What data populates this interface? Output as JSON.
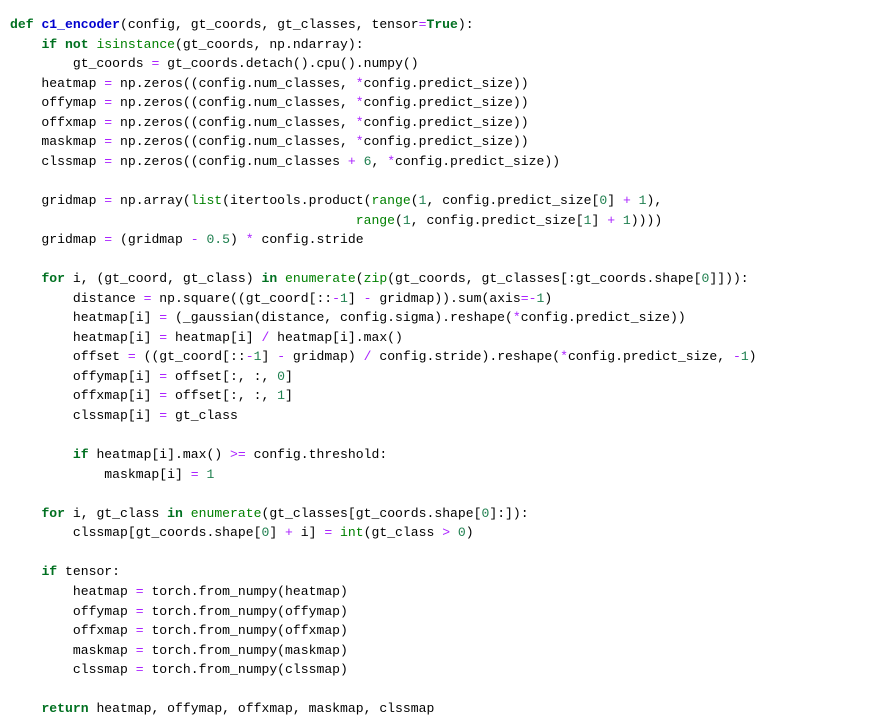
{
  "document": {
    "kind": "source-code-listing",
    "language": "Python",
    "function_name": "c1_encoder",
    "background_color": "#FFFFFF",
    "default_text_color": "#000000"
  },
  "theme": {
    "keyword": "#007020",
    "builtin": "#008000",
    "function_name": "#0000CF",
    "number": "#208050",
    "operator": "#AA22FF",
    "boolean": "#007020",
    "plain": "#000000"
  },
  "code": {
    "lines": [
      [
        {
          "t": "def",
          "c": "keyword"
        },
        {
          "t": " ",
          "c": "plain"
        },
        {
          "t": "c1_encoder",
          "c": "func"
        },
        {
          "t": "(config, gt_coords, gt_classes, tensor",
          "c": "plain"
        },
        {
          "t": "=",
          "c": "op"
        },
        {
          "t": "True",
          "c": "bool"
        },
        {
          "t": "):",
          "c": "plain"
        }
      ],
      [
        {
          "t": "    ",
          "c": "plain"
        },
        {
          "t": "if",
          "c": "keyword"
        },
        {
          "t": " ",
          "c": "plain"
        },
        {
          "t": "not",
          "c": "keyword"
        },
        {
          "t": " ",
          "c": "plain"
        },
        {
          "t": "isinstance",
          "c": "builtin"
        },
        {
          "t": "(gt_coords, np.ndarray):",
          "c": "plain"
        }
      ],
      [
        {
          "t": "        gt_coords ",
          "c": "plain"
        },
        {
          "t": "=",
          "c": "op"
        },
        {
          "t": " gt_coords.detach().cpu().numpy()",
          "c": "plain"
        }
      ],
      [
        {
          "t": "    heatmap ",
          "c": "plain"
        },
        {
          "t": "=",
          "c": "op"
        },
        {
          "t": " np.zeros((config.num_classes, ",
          "c": "plain"
        },
        {
          "t": "*",
          "c": "op"
        },
        {
          "t": "config.predict_size))",
          "c": "plain"
        }
      ],
      [
        {
          "t": "    offymap ",
          "c": "plain"
        },
        {
          "t": "=",
          "c": "op"
        },
        {
          "t": " np.zeros((config.num_classes, ",
          "c": "plain"
        },
        {
          "t": "*",
          "c": "op"
        },
        {
          "t": "config.predict_size))",
          "c": "plain"
        }
      ],
      [
        {
          "t": "    offxmap ",
          "c": "plain"
        },
        {
          "t": "=",
          "c": "op"
        },
        {
          "t": " np.zeros((config.num_classes, ",
          "c": "plain"
        },
        {
          "t": "*",
          "c": "op"
        },
        {
          "t": "config.predict_size))",
          "c": "plain"
        }
      ],
      [
        {
          "t": "    maskmap ",
          "c": "plain"
        },
        {
          "t": "=",
          "c": "op"
        },
        {
          "t": " np.zeros((config.num_classes, ",
          "c": "plain"
        },
        {
          "t": "*",
          "c": "op"
        },
        {
          "t": "config.predict_size))",
          "c": "plain"
        }
      ],
      [
        {
          "t": "    clssmap ",
          "c": "plain"
        },
        {
          "t": "=",
          "c": "op"
        },
        {
          "t": " np.zeros((config.num_classes ",
          "c": "plain"
        },
        {
          "t": "+",
          "c": "op"
        },
        {
          "t": " ",
          "c": "plain"
        },
        {
          "t": "6",
          "c": "number"
        },
        {
          "t": ", ",
          "c": "plain"
        },
        {
          "t": "*",
          "c": "op"
        },
        {
          "t": "config.predict_size))",
          "c": "plain"
        }
      ],
      [],
      [
        {
          "t": "    gridmap ",
          "c": "plain"
        },
        {
          "t": "=",
          "c": "op"
        },
        {
          "t": " np.array(",
          "c": "plain"
        },
        {
          "t": "list",
          "c": "builtin"
        },
        {
          "t": "(itertools.product(",
          "c": "plain"
        },
        {
          "t": "range",
          "c": "builtin"
        },
        {
          "t": "(",
          "c": "plain"
        },
        {
          "t": "1",
          "c": "number"
        },
        {
          "t": ", config.predict_size[",
          "c": "plain"
        },
        {
          "t": "0",
          "c": "number"
        },
        {
          "t": "] ",
          "c": "plain"
        },
        {
          "t": "+",
          "c": "op"
        },
        {
          "t": " ",
          "c": "plain"
        },
        {
          "t": "1",
          "c": "number"
        },
        {
          "t": "),",
          "c": "plain"
        }
      ],
      [
        {
          "t": "                                            ",
          "c": "plain"
        },
        {
          "t": "range",
          "c": "builtin"
        },
        {
          "t": "(",
          "c": "plain"
        },
        {
          "t": "1",
          "c": "number"
        },
        {
          "t": ", config.predict_size[",
          "c": "plain"
        },
        {
          "t": "1",
          "c": "number"
        },
        {
          "t": "] ",
          "c": "plain"
        },
        {
          "t": "+",
          "c": "op"
        },
        {
          "t": " ",
          "c": "plain"
        },
        {
          "t": "1",
          "c": "number"
        },
        {
          "t": "))))",
          "c": "plain"
        }
      ],
      [
        {
          "t": "    gridmap ",
          "c": "plain"
        },
        {
          "t": "=",
          "c": "op"
        },
        {
          "t": " (gridmap ",
          "c": "plain"
        },
        {
          "t": "-",
          "c": "op"
        },
        {
          "t": " ",
          "c": "plain"
        },
        {
          "t": "0.5",
          "c": "number"
        },
        {
          "t": ") ",
          "c": "plain"
        },
        {
          "t": "*",
          "c": "op"
        },
        {
          "t": " config.stride",
          "c": "plain"
        }
      ],
      [],
      [
        {
          "t": "    ",
          "c": "plain"
        },
        {
          "t": "for",
          "c": "keyword"
        },
        {
          "t": " i, (gt_coord, gt_class) ",
          "c": "plain"
        },
        {
          "t": "in",
          "c": "keyword"
        },
        {
          "t": " ",
          "c": "plain"
        },
        {
          "t": "enumerate",
          "c": "builtin"
        },
        {
          "t": "(",
          "c": "plain"
        },
        {
          "t": "zip",
          "c": "builtin"
        },
        {
          "t": "(gt_coords, gt_classes[:gt_coords.shape[",
          "c": "plain"
        },
        {
          "t": "0",
          "c": "number"
        },
        {
          "t": "]])):",
          "c": "plain"
        }
      ],
      [
        {
          "t": "        distance ",
          "c": "plain"
        },
        {
          "t": "=",
          "c": "op"
        },
        {
          "t": " np.square((gt_coord[::",
          "c": "plain"
        },
        {
          "t": "-",
          "c": "op"
        },
        {
          "t": "1",
          "c": "number"
        },
        {
          "t": "] ",
          "c": "plain"
        },
        {
          "t": "-",
          "c": "op"
        },
        {
          "t": " gridmap)).sum(axis",
          "c": "plain"
        },
        {
          "t": "=",
          "c": "op"
        },
        {
          "t": "-",
          "c": "op"
        },
        {
          "t": "1",
          "c": "number"
        },
        {
          "t": ")",
          "c": "plain"
        }
      ],
      [
        {
          "t": "        heatmap[i] ",
          "c": "plain"
        },
        {
          "t": "=",
          "c": "op"
        },
        {
          "t": " (_gaussian(distance, config.sigma).reshape(",
          "c": "plain"
        },
        {
          "t": "*",
          "c": "op"
        },
        {
          "t": "config.predict_size))",
          "c": "plain"
        }
      ],
      [
        {
          "t": "        heatmap[i] ",
          "c": "plain"
        },
        {
          "t": "=",
          "c": "op"
        },
        {
          "t": " heatmap[i] ",
          "c": "plain"
        },
        {
          "t": "/",
          "c": "op"
        },
        {
          "t": " heatmap[i].max()",
          "c": "plain"
        }
      ],
      [
        {
          "t": "        offset ",
          "c": "plain"
        },
        {
          "t": "=",
          "c": "op"
        },
        {
          "t": " ((gt_coord[::",
          "c": "plain"
        },
        {
          "t": "-",
          "c": "op"
        },
        {
          "t": "1",
          "c": "number"
        },
        {
          "t": "] ",
          "c": "plain"
        },
        {
          "t": "-",
          "c": "op"
        },
        {
          "t": " gridmap) ",
          "c": "plain"
        },
        {
          "t": "/",
          "c": "op"
        },
        {
          "t": " config.stride).reshape(",
          "c": "plain"
        },
        {
          "t": "*",
          "c": "op"
        },
        {
          "t": "config.predict_size, ",
          "c": "plain"
        },
        {
          "t": "-",
          "c": "op"
        },
        {
          "t": "1",
          "c": "number"
        },
        {
          "t": ")",
          "c": "plain"
        }
      ],
      [
        {
          "t": "        offymap[i] ",
          "c": "plain"
        },
        {
          "t": "=",
          "c": "op"
        },
        {
          "t": " offset[:, :, ",
          "c": "plain"
        },
        {
          "t": "0",
          "c": "number"
        },
        {
          "t": "]",
          "c": "plain"
        }
      ],
      [
        {
          "t": "        offxmap[i] ",
          "c": "plain"
        },
        {
          "t": "=",
          "c": "op"
        },
        {
          "t": " offset[:, :, ",
          "c": "plain"
        },
        {
          "t": "1",
          "c": "number"
        },
        {
          "t": "]",
          "c": "plain"
        }
      ],
      [
        {
          "t": "        clssmap[i] ",
          "c": "plain"
        },
        {
          "t": "=",
          "c": "op"
        },
        {
          "t": " gt_class",
          "c": "plain"
        }
      ],
      [],
      [
        {
          "t": "        ",
          "c": "plain"
        },
        {
          "t": "if",
          "c": "keyword"
        },
        {
          "t": " heatmap[i].max() ",
          "c": "plain"
        },
        {
          "t": ">=",
          "c": "op"
        },
        {
          "t": " config.threshold:",
          "c": "plain"
        }
      ],
      [
        {
          "t": "            maskmap[i] ",
          "c": "plain"
        },
        {
          "t": "=",
          "c": "op"
        },
        {
          "t": " ",
          "c": "plain"
        },
        {
          "t": "1",
          "c": "number"
        }
      ],
      [],
      [
        {
          "t": "    ",
          "c": "plain"
        },
        {
          "t": "for",
          "c": "keyword"
        },
        {
          "t": " i, gt_class ",
          "c": "plain"
        },
        {
          "t": "in",
          "c": "keyword"
        },
        {
          "t": " ",
          "c": "plain"
        },
        {
          "t": "enumerate",
          "c": "builtin"
        },
        {
          "t": "(gt_classes[gt_coords.shape[",
          "c": "plain"
        },
        {
          "t": "0",
          "c": "number"
        },
        {
          "t": "]:]):",
          "c": "plain"
        }
      ],
      [
        {
          "t": "        clssmap[gt_coords.shape[",
          "c": "plain"
        },
        {
          "t": "0",
          "c": "number"
        },
        {
          "t": "] ",
          "c": "plain"
        },
        {
          "t": "+",
          "c": "op"
        },
        {
          "t": " i] ",
          "c": "plain"
        },
        {
          "t": "=",
          "c": "op"
        },
        {
          "t": " ",
          "c": "plain"
        },
        {
          "t": "int",
          "c": "builtin"
        },
        {
          "t": "(gt_class ",
          "c": "plain"
        },
        {
          "t": ">",
          "c": "op"
        },
        {
          "t": " ",
          "c": "plain"
        },
        {
          "t": "0",
          "c": "number"
        },
        {
          "t": ")",
          "c": "plain"
        }
      ],
      [],
      [
        {
          "t": "    ",
          "c": "plain"
        },
        {
          "t": "if",
          "c": "keyword"
        },
        {
          "t": " tensor:",
          "c": "plain"
        }
      ],
      [
        {
          "t": "        heatmap ",
          "c": "plain"
        },
        {
          "t": "=",
          "c": "op"
        },
        {
          "t": " torch.from_numpy(heatmap)",
          "c": "plain"
        }
      ],
      [
        {
          "t": "        offymap ",
          "c": "plain"
        },
        {
          "t": "=",
          "c": "op"
        },
        {
          "t": " torch.from_numpy(offymap)",
          "c": "plain"
        }
      ],
      [
        {
          "t": "        offxmap ",
          "c": "plain"
        },
        {
          "t": "=",
          "c": "op"
        },
        {
          "t": " torch.from_numpy(offxmap)",
          "c": "plain"
        }
      ],
      [
        {
          "t": "        maskmap ",
          "c": "plain"
        },
        {
          "t": "=",
          "c": "op"
        },
        {
          "t": " torch.from_numpy(maskmap)",
          "c": "plain"
        }
      ],
      [
        {
          "t": "        clssmap ",
          "c": "plain"
        },
        {
          "t": "=",
          "c": "op"
        },
        {
          "t": " torch.from_numpy(clssmap)",
          "c": "plain"
        }
      ],
      [],
      [
        {
          "t": "    ",
          "c": "plain"
        },
        {
          "t": "return",
          "c": "keyword"
        },
        {
          "t": " heatmap, offymap, offxmap, maskmap, clssmap",
          "c": "plain"
        }
      ]
    ]
  }
}
